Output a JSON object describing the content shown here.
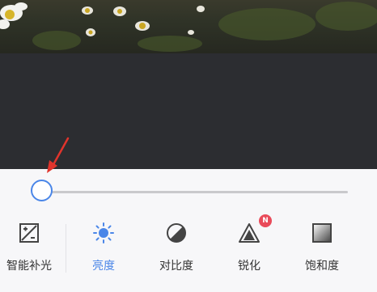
{
  "editor": {
    "slider": {
      "value_fraction": 0.0
    },
    "tools": [
      {
        "label": "智能补光",
        "icon": "auto-fill-light-icon",
        "active": false
      },
      {
        "label": "亮度",
        "icon": "brightness-icon",
        "active": true
      },
      {
        "label": "对比度",
        "icon": "contrast-icon",
        "active": false
      },
      {
        "label": "锐化",
        "icon": "sharpen-icon",
        "active": false,
        "badge": "N"
      },
      {
        "label": "饱和度",
        "icon": "saturation-icon",
        "active": false
      }
    ]
  },
  "colors": {
    "accent": "#4a86e8",
    "panel_bg": "#f7f7f9",
    "dark_bg": "#2c2d31",
    "badge": "#e94b5a",
    "annotation_arrow": "#e0342c"
  }
}
